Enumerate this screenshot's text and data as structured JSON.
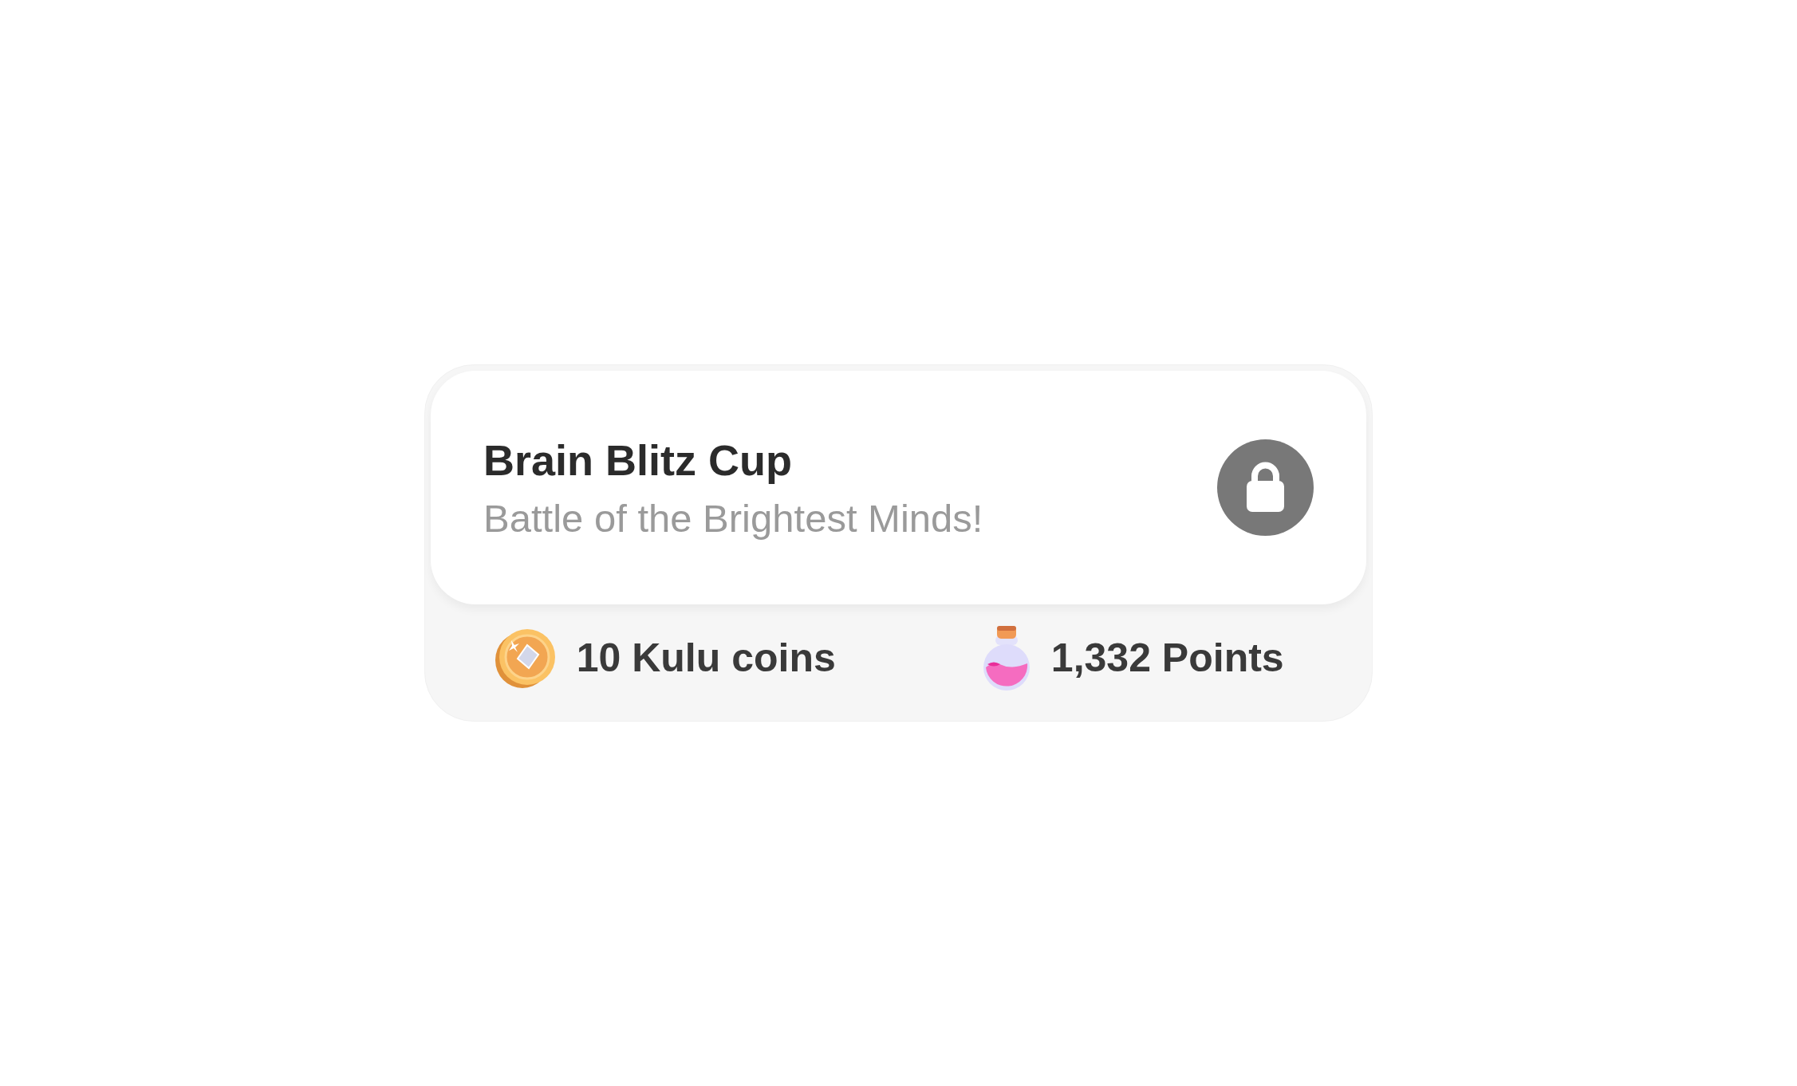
{
  "challenge": {
    "title": "Brain Blitz Cup",
    "subtitle": "Battle of the Brightest Minds!",
    "locked": true
  },
  "rewards": [
    {
      "kind": "coin",
      "label": "10 Kulu coins"
    },
    {
      "kind": "potion",
      "label": "1,332 Points"
    }
  ]
}
